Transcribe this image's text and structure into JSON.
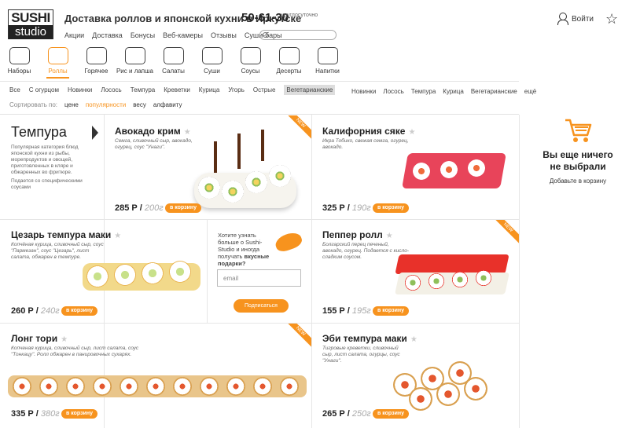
{
  "header": {
    "logo_line1": "SUSHI",
    "logo_line2": "studio",
    "tagline": "Доставка роллов и японской кухни в Иркутске",
    "phone": "50-61-30",
    "phone_note": "круглосуточно",
    "nav": [
      "Акции",
      "Доставка",
      "Бонусы",
      "Веб-камеры",
      "Отзывы",
      "Суши-бары"
    ],
    "search_placeholder": "",
    "login": "Войти"
  },
  "categories": [
    {
      "label": "Наборы",
      "icon": "set-icon"
    },
    {
      "label": "Роллы",
      "icon": "rolls-icon",
      "active": true
    },
    {
      "label": "Горячее",
      "icon": "hot-dish-icon"
    },
    {
      "label": "Рис и лапша",
      "icon": "noodle-box-icon"
    },
    {
      "label": "Салаты",
      "icon": "salad-icon"
    },
    {
      "label": "Суши",
      "icon": "sushi-icon"
    },
    {
      "label": "Соусы",
      "icon": "sauce-icon"
    },
    {
      "label": "Десерты",
      "icon": "dessert-icon"
    },
    {
      "label": "Напитки",
      "icon": "teapot-icon"
    }
  ],
  "filters": [
    "Все",
    "С огурцом",
    "Новинки",
    "Лосось",
    "Темпура",
    "Креветки",
    "Курица",
    "Угорь",
    "Острые",
    "Вегетарианские"
  ],
  "filters_selected": "Вегетарианские",
  "filters_more": [
    "Новинки",
    "Лосось",
    "Темпура",
    "Курица",
    "Вегетарианские",
    "ещё"
  ],
  "sort": {
    "label": "Сортировать по:",
    "options": [
      "цене",
      "популярности",
      "весу",
      "алфавиту"
    ],
    "active": "популярности"
  },
  "section": {
    "title": "Темпура",
    "desc": "Популярная категория блюд японской кухни из рыбы, морепродуктов и овощей, приготовленных в кляре и обжаренных во фритюре.",
    "note": "Подается со специфическими соусами"
  },
  "products": [
    {
      "name": "Авокадо крим",
      "desc": "Семга, сливочный сыр, авокадо, огурец, соус \"Унаги\".",
      "price": "285 Р",
      "weight": "200г",
      "button": "в корзину",
      "new": "NEW"
    },
    {
      "name": "Калифорния сяке",
      "desc": "Икра Тобико, свежая семга, огурец, авокадо.",
      "price": "325 Р",
      "weight": "190г",
      "button": "в корзину",
      "new": ""
    },
    {
      "name": "Цезарь темпура маки",
      "desc": "Копчёная курица, сливочный сыр, соус \"Пармезан\", соус \"Цезарь\", лист салата, обжарен в темпуре.",
      "price": "260 Р",
      "weight": "240г",
      "button": "в корзину",
      "new": ""
    },
    {
      "name": "Пеппер ролл",
      "desc": "Болгарский перец печеный, авокадо, огурец. Подается с кисло-сладким соусом.",
      "price": "155 Р",
      "weight": "195г",
      "button": "в корзину",
      "new": "NEW"
    },
    {
      "name": "Лонг тори",
      "desc": "Копченая курица, сливочный сыр, лист салата, соус \"Тонкацу\". Ролл обжарен в панировочных сухарях.",
      "price": "335 Р",
      "weight": "380г",
      "button": "в корзину",
      "new": "NEW"
    },
    {
      "name": "Эби темпура маки",
      "desc": "Тигровые креветки, сливочный сыр, лист салата, огурцы, соус \"Унаги\".",
      "price": "265 Р",
      "weight": "250г",
      "button": "в корзину",
      "new": ""
    }
  ],
  "promo": {
    "text1": "Хотите узнать больше о Sushi-Studio и иногда получать",
    "text2": "вкусные подарки?",
    "email_placeholder": "email",
    "button": "Подписаться"
  },
  "cart": {
    "message": "Вы еще ничего не выбрали",
    "sub": "Добавьте в корзину"
  },
  "colors": {
    "accent": "#f7931e",
    "text": "#222"
  }
}
